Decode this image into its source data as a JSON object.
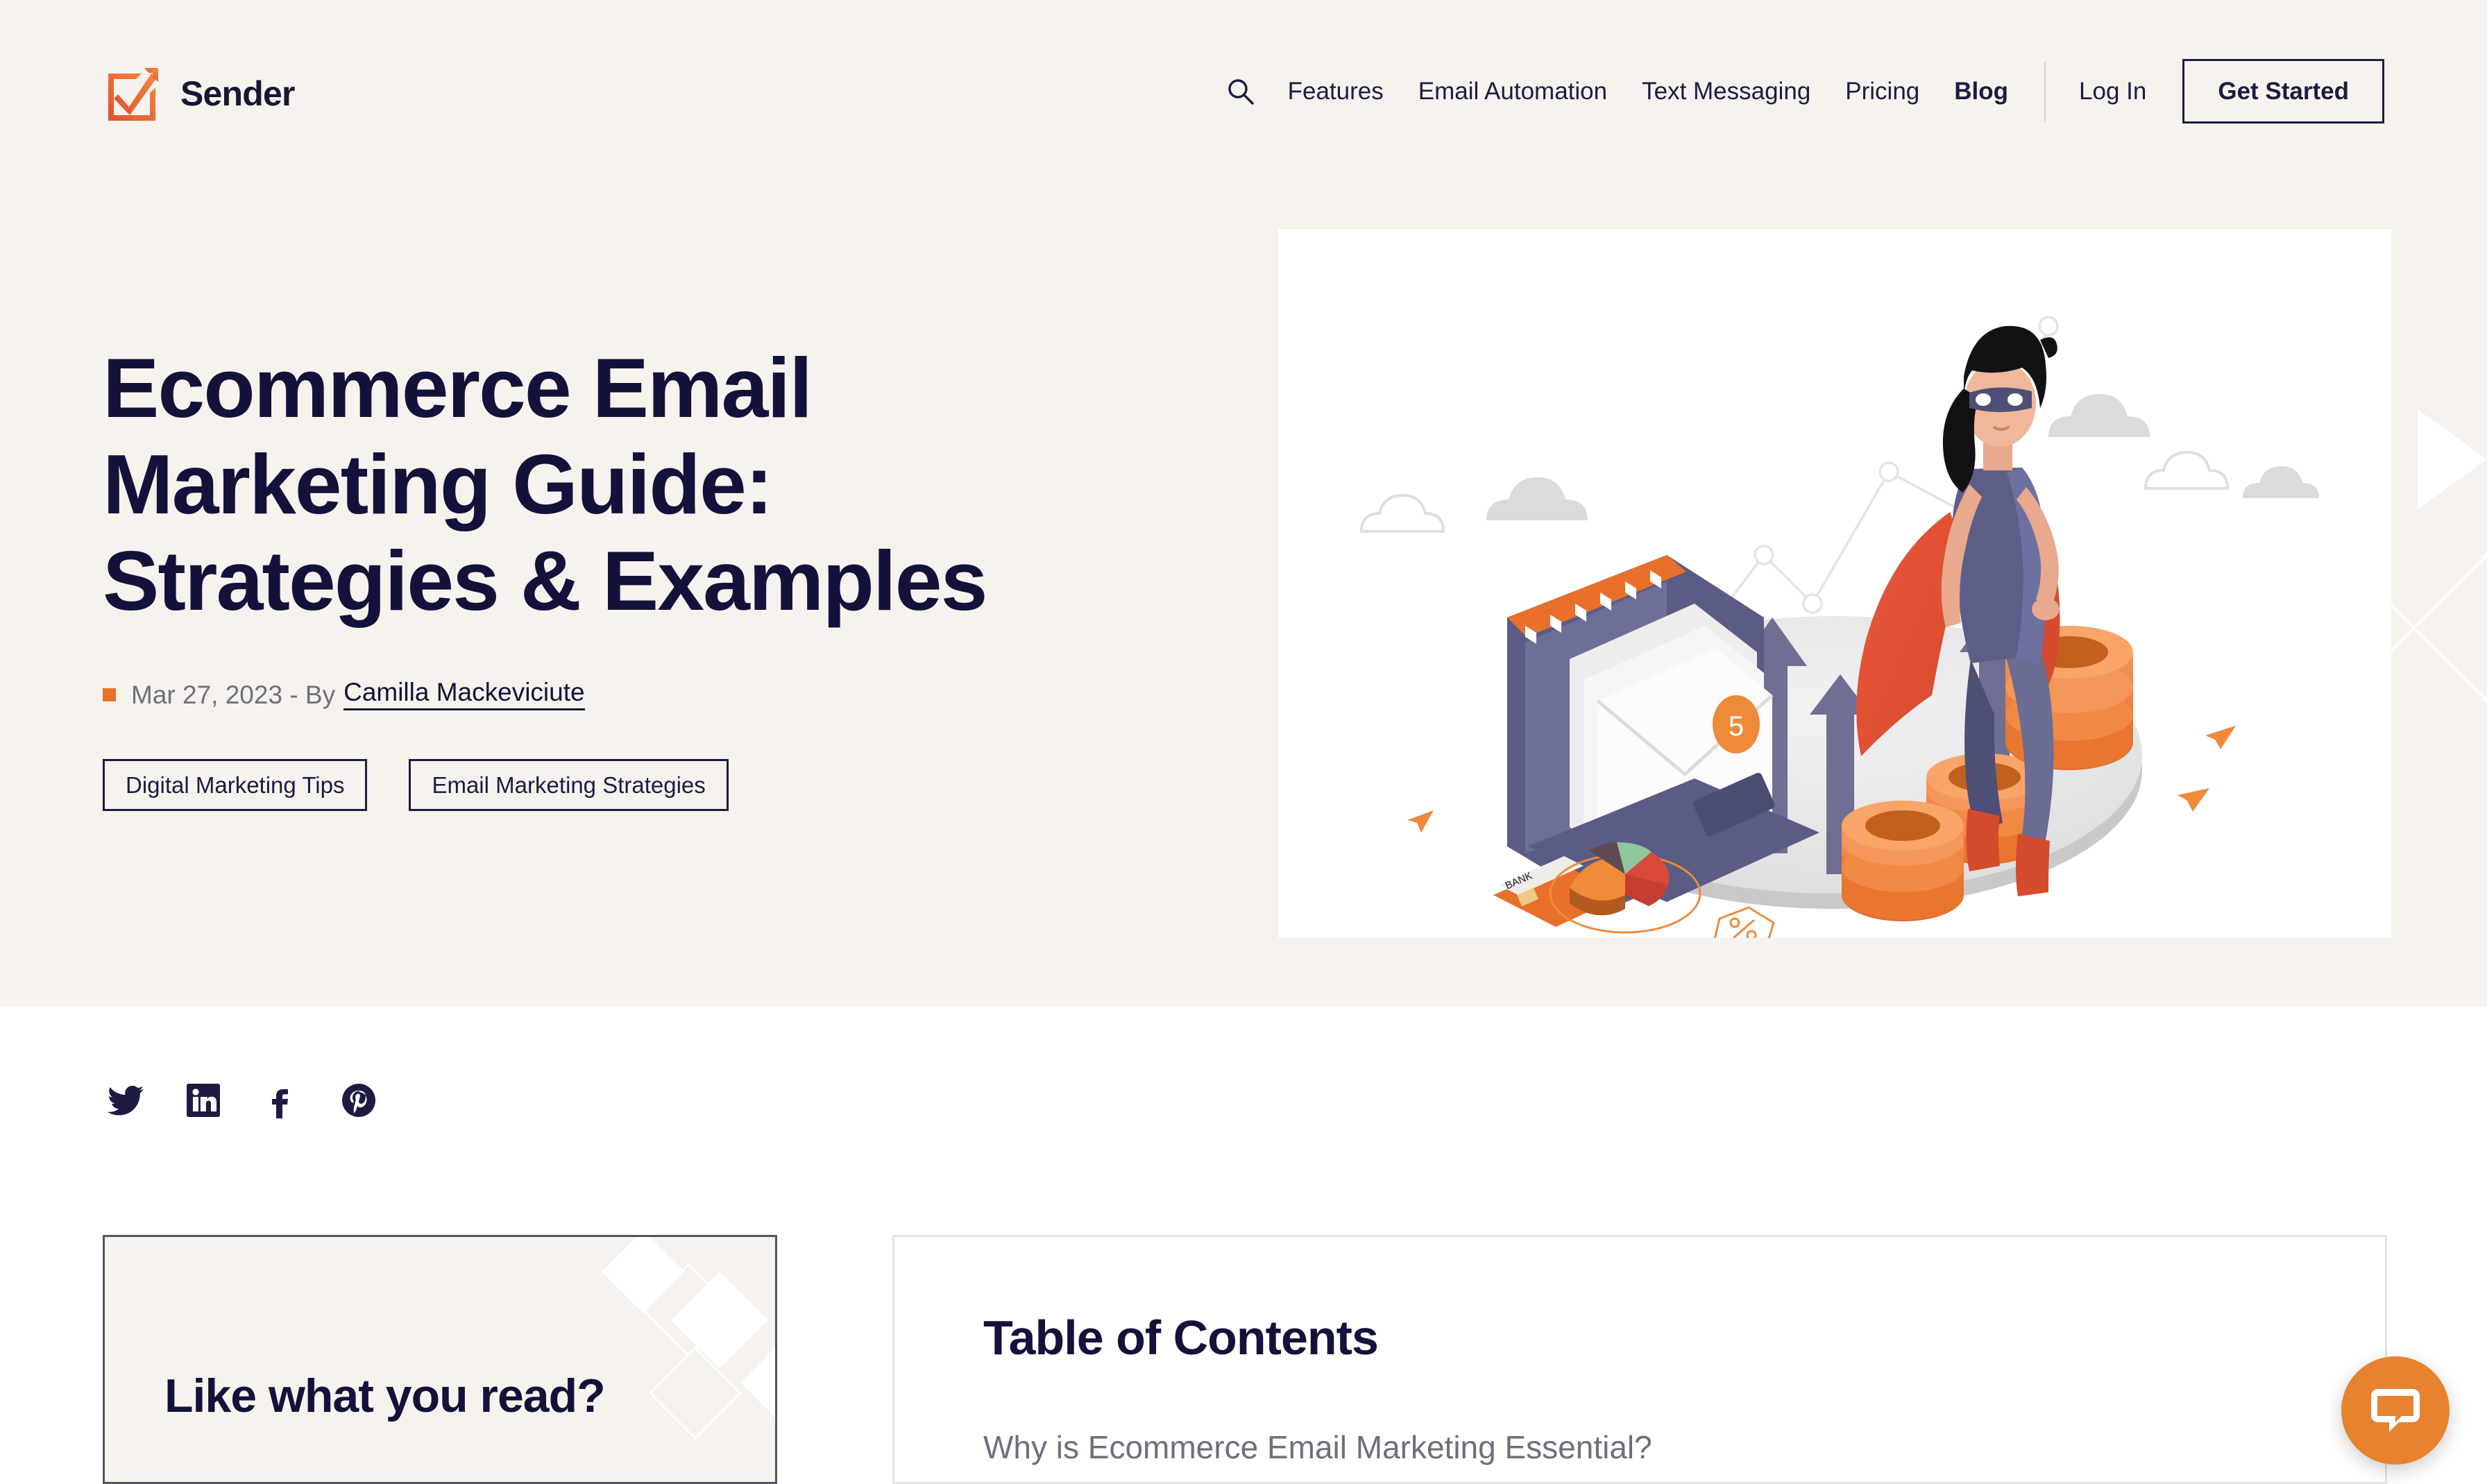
{
  "brand": {
    "name": "Sender",
    "logo_icon": "sender-checkbox-arrow-logo"
  },
  "nav": {
    "search_icon": "search-icon",
    "links": [
      {
        "label": "Features",
        "active": false
      },
      {
        "label": "Email Automation",
        "active": false
      },
      {
        "label": "Text Messaging",
        "active": false
      },
      {
        "label": "Pricing",
        "active": false
      },
      {
        "label": "Blog",
        "active": true
      }
    ],
    "login_label": "Log In",
    "cta_label": "Get Started"
  },
  "hero": {
    "title": "Ecommerce Email Marketing Guide: Strategies & Examples",
    "date": "Mar 27, 2023 - By",
    "author": "Camilla Mackeviciute",
    "tags": [
      "Digital Marketing Tips",
      "Email Marketing Strategies"
    ],
    "illustration_alt": "superhero-ecommerce-email-illustration",
    "background_color": "#F6F2EE",
    "accent_color": "#E8702A",
    "text_color": "#14123A"
  },
  "share": {
    "items": [
      {
        "icon": "twitter-icon",
        "label": "Twitter"
      },
      {
        "icon": "linkedin-icon",
        "label": "LinkedIn"
      },
      {
        "icon": "facebook-icon",
        "label": "Facebook"
      },
      {
        "icon": "pinterest-icon",
        "label": "Pinterest"
      }
    ]
  },
  "promo": {
    "title": "Like what you read?"
  },
  "toc": {
    "title": "Table of Contents",
    "items": [
      "Why is Ecommerce Email Marketing Essential?"
    ]
  },
  "chat": {
    "icon": "chat-bubble-icon",
    "color": "#E8822E"
  }
}
